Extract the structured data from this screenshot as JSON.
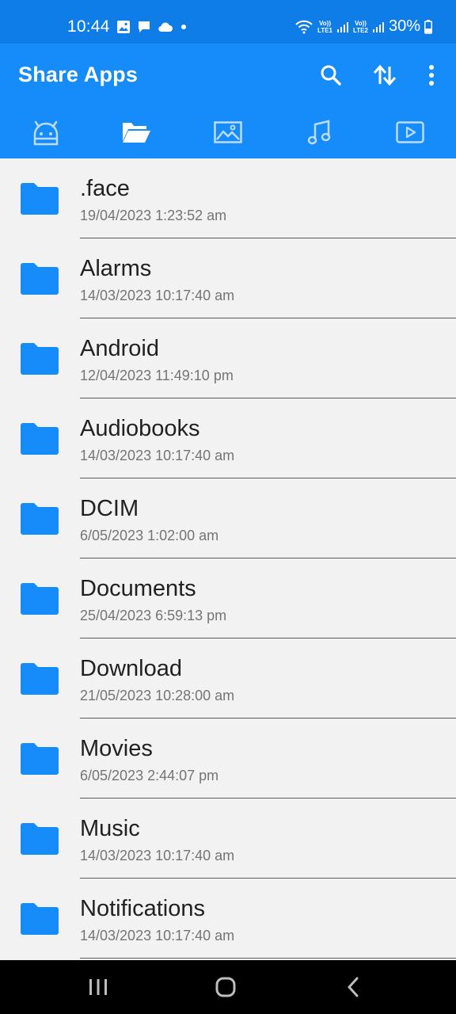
{
  "status_bar": {
    "time": "10:44",
    "battery": "30%",
    "sim1": {
      "top": "Vo))",
      "bottom": "LTE1"
    },
    "sim2": {
      "top": "Vo))",
      "bottom": "LTE2"
    }
  },
  "app_bar": {
    "title": "Share Apps",
    "accent": "#168bfa"
  },
  "tabs": [
    {
      "icon": "android-icon",
      "selected": false
    },
    {
      "icon": "folder-open-icon",
      "selected": true
    },
    {
      "icon": "image-icon",
      "selected": false
    },
    {
      "icon": "music-icon",
      "selected": false
    },
    {
      "icon": "video-icon",
      "selected": false
    }
  ],
  "files": [
    {
      "name": ".face",
      "date": "19/04/2023 1:23:52 am"
    },
    {
      "name": "Alarms",
      "date": "14/03/2023 10:17:40 am"
    },
    {
      "name": "Android",
      "date": "12/04/2023 11:49:10 pm"
    },
    {
      "name": "Audiobooks",
      "date": "14/03/2023 10:17:40 am"
    },
    {
      "name": "DCIM",
      "date": "6/05/2023 1:02:00 am"
    },
    {
      "name": "Documents",
      "date": "25/04/2023 6:59:13 pm"
    },
    {
      "name": "Download",
      "date": "21/05/2023 10:28:00 am"
    },
    {
      "name": "Movies",
      "date": "6/05/2023 2:44:07 pm"
    },
    {
      "name": "Music",
      "date": "14/03/2023 10:17:40 am"
    },
    {
      "name": "Notifications",
      "date": "14/03/2023 10:17:40 am"
    }
  ]
}
